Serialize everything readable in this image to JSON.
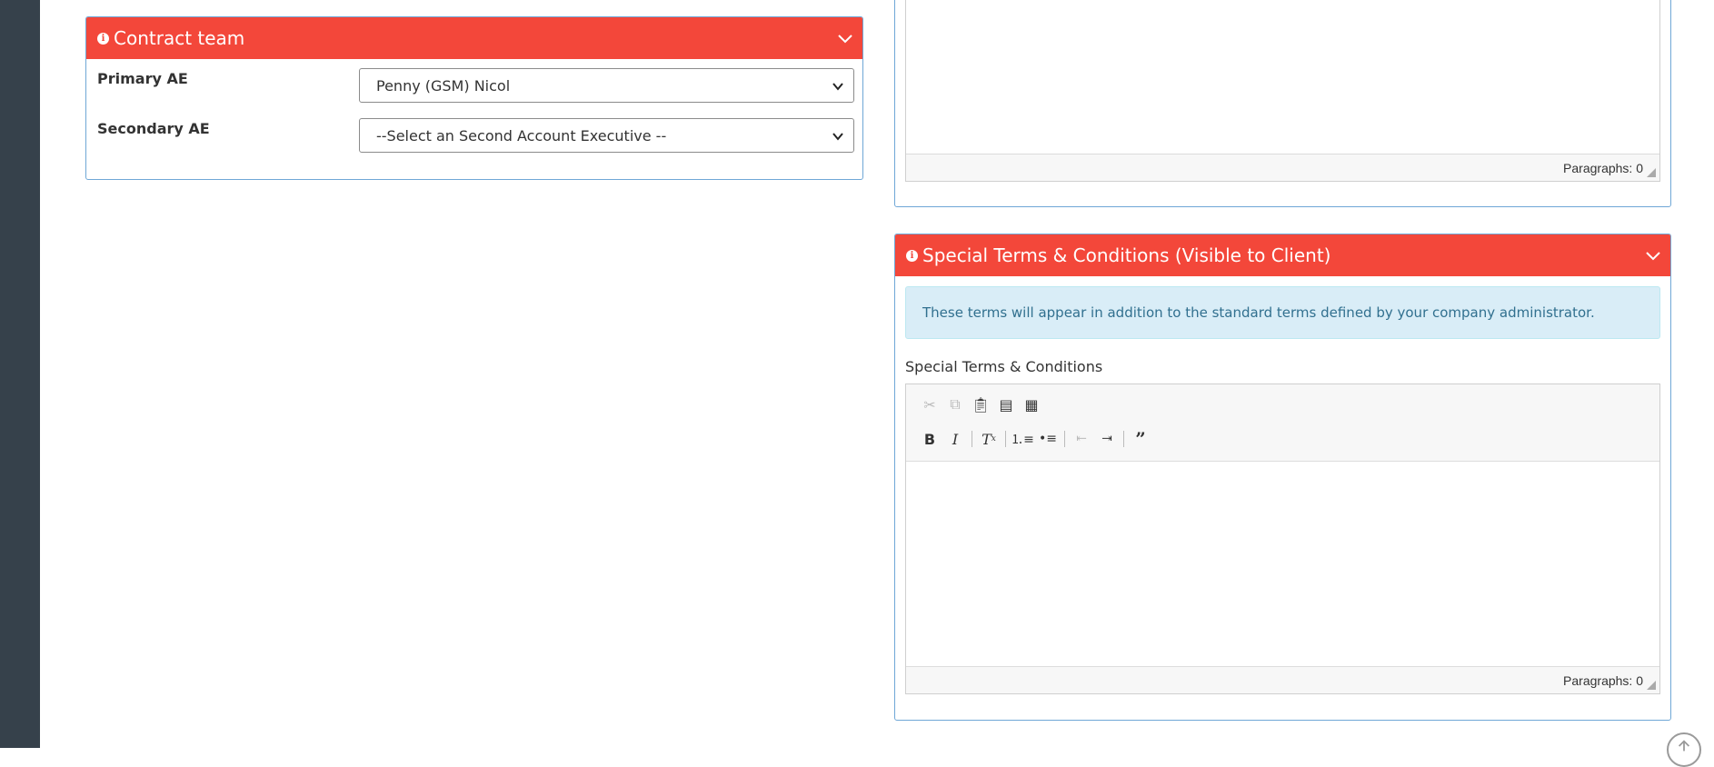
{
  "contract_team": {
    "title": "Contract team",
    "primary_label": "Primary AE",
    "primary_value": "Penny (GSM) Nicol",
    "secondary_label": "Secondary AE",
    "secondary_value": "--Select an Second Account Executive --"
  },
  "top_editor": {
    "status": "Paragraphs: 0"
  },
  "special_terms": {
    "title": "Special Terms & Conditions (Visible to Client)",
    "notice": "These terms will appear in addition to the standard terms defined by your company administrator.",
    "field_label": "Special Terms & Conditions",
    "status": "Paragraphs: 0",
    "toolbar_row1": [
      "cut-icon",
      "copy-icon",
      "paste-icon",
      "paste-text-icon",
      "paste-word-icon"
    ],
    "toolbar_row2": [
      "bold-icon",
      "italic-icon",
      "remove-format-icon",
      "numbered-list-icon",
      "bulleted-list-icon",
      "outdent-icon",
      "indent-icon",
      "blockquote-icon"
    ]
  },
  "colors": {
    "header_red": "#f3473a",
    "panel_border": "#6fa7d6",
    "sidebar": "#36414b",
    "alert_bg": "#d9edf7",
    "alert_text": "#31708f"
  }
}
